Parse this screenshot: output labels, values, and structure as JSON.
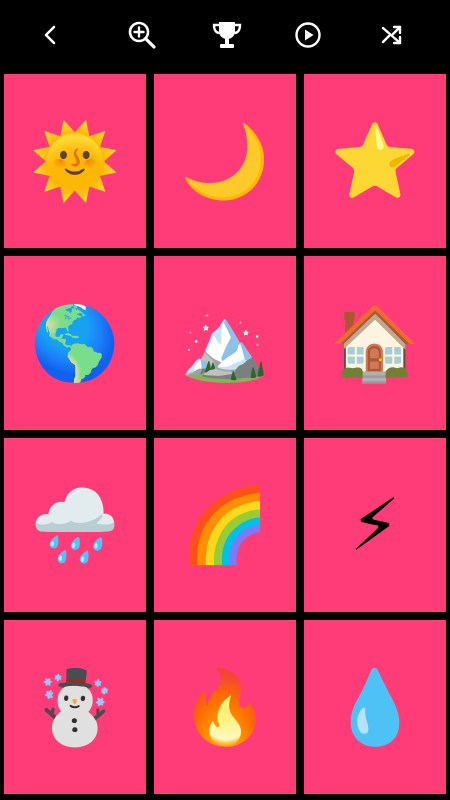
{
  "toolbar": {
    "buttons": [
      {
        "icon": "chevron-left-icon"
      },
      {
        "icon": "zoom-in-icon"
      },
      {
        "icon": "trophy-icon"
      },
      {
        "icon": "play-circle-icon"
      },
      {
        "icon": "shuffle-icon"
      }
    ],
    "icon_color": "#ffffff",
    "background": "#000000"
  },
  "grid": {
    "tile_color": "#ff3c78",
    "gap_color": "#000000",
    "columns": 3,
    "rows": 4,
    "tiles": [
      {
        "emoji": "🌞",
        "name": "sun"
      },
      {
        "emoji": "🌙",
        "name": "moon"
      },
      {
        "emoji": "⭐",
        "name": "star"
      },
      {
        "emoji": "🌎",
        "name": "earth"
      },
      {
        "emoji": "🏔️",
        "name": "mountain"
      },
      {
        "emoji": "🏠",
        "name": "house"
      },
      {
        "emoji": "🌧️",
        "name": "rain-cloud"
      },
      {
        "emoji": "🌈",
        "name": "rainbow"
      },
      {
        "emoji": "⚡",
        "name": "lightning"
      },
      {
        "emoji": "☃️",
        "name": "snowman"
      },
      {
        "emoji": "🔥",
        "name": "fire"
      },
      {
        "emoji": "💧",
        "name": "water-drop"
      }
    ]
  }
}
